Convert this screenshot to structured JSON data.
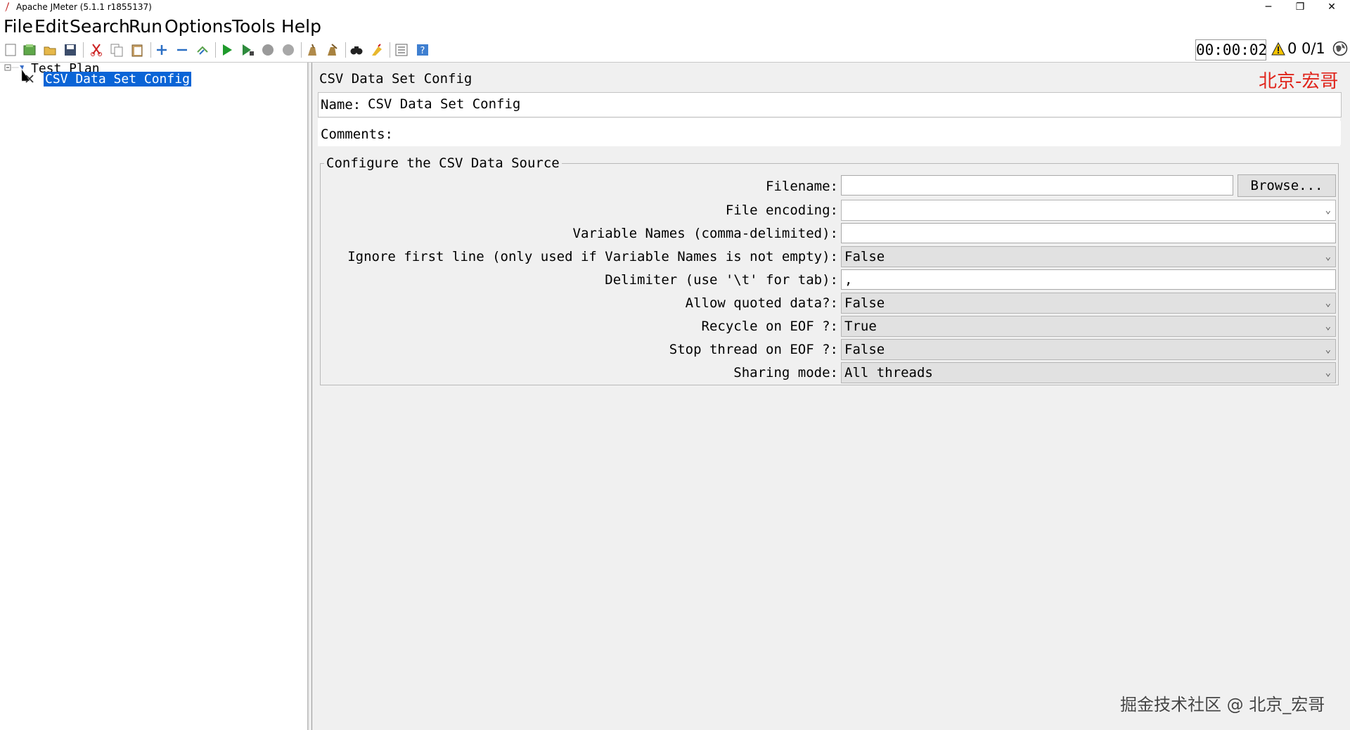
{
  "window": {
    "title": "Apache JMeter (5.1.1 r1855137)",
    "controls": {
      "minimize": "─",
      "restore": "❐",
      "close": "✕"
    }
  },
  "menu": [
    "File",
    "Edit",
    "Search",
    "Run",
    "Options",
    "Tools",
    "Help"
  ],
  "toolbar": {
    "icons": [
      "new-icon",
      "templates-icon",
      "open-icon",
      "save-icon",
      "cut-icon",
      "copy-icon",
      "paste-icon",
      "expand-icon",
      "collapse-icon",
      "toggle-icon",
      "start-icon",
      "start-no-pause-icon",
      "stop-icon",
      "shutdown-icon",
      "clear-icon",
      "clear-all-icon",
      "search-icon",
      "reset-search-icon",
      "function-helper-icon",
      "help-icon"
    ],
    "timer": "00:00:02",
    "error_count": "0",
    "threads": "0/1"
  },
  "tree": {
    "root": "Test Plan",
    "child": "CSV Data Set Config"
  },
  "panel": {
    "title": "CSV Data Set Config",
    "watermark": "北京-宏哥",
    "name_label": "Name:",
    "name_value": "CSV Data Set Config",
    "comments_label": "Comments:",
    "comments_value": "",
    "group_title": "Configure the CSV Data Source",
    "fields": {
      "filename": {
        "label": "Filename:",
        "value": ""
      },
      "browse": "Browse...",
      "encoding": {
        "label": "File encoding:",
        "value": ""
      },
      "variable_names": {
        "label": "Variable Names (comma-delimited):",
        "value": ""
      },
      "ignore_first": {
        "label": "Ignore first line (only used if Variable Names is not empty):",
        "value": "False"
      },
      "delimiter": {
        "label": "Delimiter (use '\\t' for tab):",
        "value": ","
      },
      "quoted": {
        "label": "Allow quoted data?:",
        "value": "False"
      },
      "recycle": {
        "label": "Recycle on EOF ?:",
        "value": "True"
      },
      "stop_thread": {
        "label": "Stop thread on EOF ?:",
        "value": "False"
      },
      "sharing": {
        "label": "Sharing mode:",
        "value": "All threads"
      }
    }
  },
  "footer_watermark": "掘金技术社区 @ 北京_宏哥"
}
